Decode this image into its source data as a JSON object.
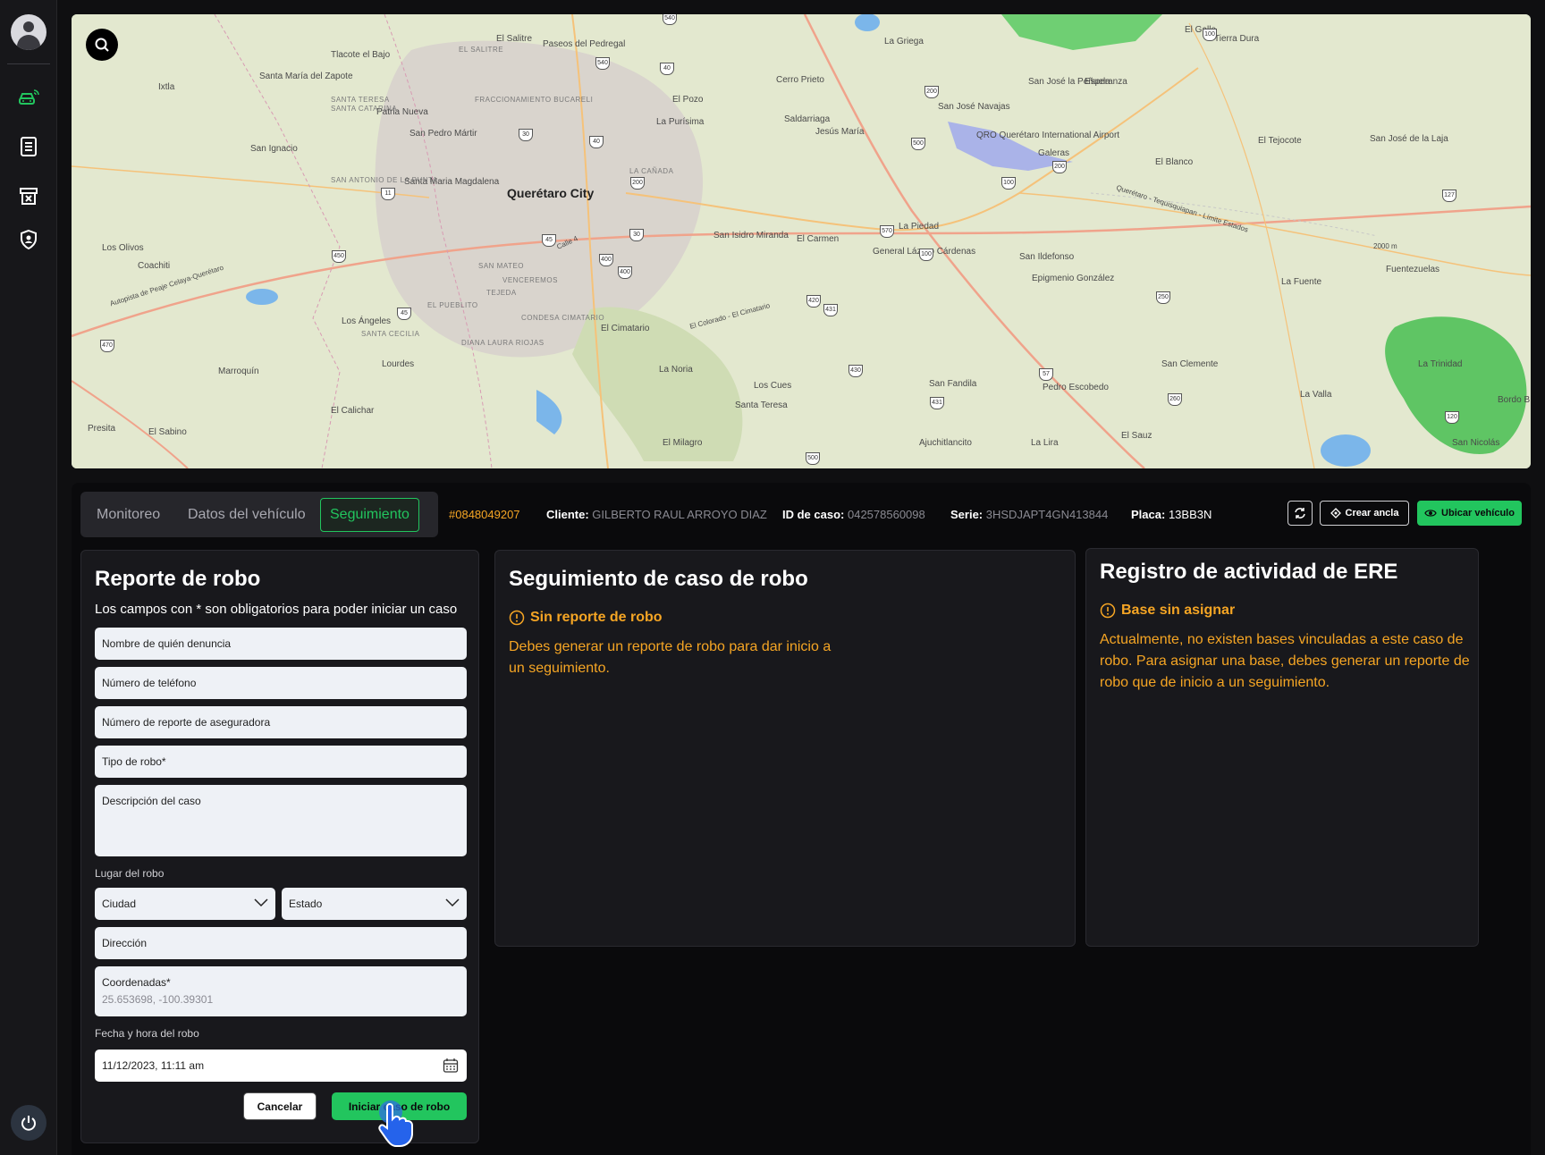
{
  "sidebar": {
    "items": [
      {
        "icon": "car-signal-icon",
        "label": "Vehículos"
      },
      {
        "icon": "report-list-icon",
        "label": "Reportes"
      },
      {
        "icon": "archive-x-icon",
        "label": "Archivo"
      },
      {
        "icon": "shield-user-icon",
        "label": "Seguridad"
      }
    ]
  },
  "map": {
    "labels": [
      "Querétaro City",
      "Santa María del Zapote",
      "Tlacote el Bajo",
      "El Salitre",
      "Paseos del Pedregal",
      "La Griega",
      "El Gallo",
      "Tierra Dura",
      "San Ignacio",
      "San Pedro Mártir",
      "Santa Maria Magdalena",
      "El Pozo",
      "La Purísima",
      "Cerro Prieto",
      "Saldarriaga",
      "Jesús María",
      "San José Navajas",
      "San José la Peñuela",
      "Esperanza",
      "Galeras",
      "El Blanco",
      "El Tejocote",
      "San José de la Laja",
      "QRO Querétaro International Airport",
      "La Piedad",
      "El Carmen",
      "San Isidro Miranda",
      "General Lázaro Cárdenas",
      "San Ildefonso",
      "Epigmenio González",
      "La Fuente",
      "Fuentezuelas",
      "Los Ángeles",
      "Lourdes",
      "El Cimatario",
      "La Noria",
      "San Clemente",
      "Pedro Escobedo",
      "San Fandila",
      "Los Cues",
      "La Valla",
      "La Trinidad",
      "El Calichar",
      "Santa Teresa",
      "El Milagro",
      "Ajuchitlancito",
      "La Lira",
      "El Sauz",
      "San Nicolás",
      "Bordo B",
      "Patria Nueva",
      "Marroquín",
      "El Sabino",
      "Presita",
      "Coachiti",
      "Los Olivos",
      "Ixtla"
    ],
    "districts": [
      "EL SALITRE",
      "FRACCIONAMIENTO BUCARELI",
      "SANTA CATARINA",
      "SANTA TERESA",
      "SAN MATEO",
      "VENCEREMOS",
      "EL PUEBLITO",
      "TEJEDA",
      "CONDESA CIMATARIO",
      "DIANA LAURA RIOJAS",
      "SANTA CECILIA",
      "LA CAÑADA",
      "SAN ANTONIO DE LA PUNTA"
    ],
    "road_labels": [
      "Autopista de Peaje Celaya-Querétaro",
      "Calle 4",
      "El Colorado - El Cimatario",
      "Querétaro - Tequisquiapan - Límite Estados",
      "2000 m"
    ],
    "highways": [
      "540",
      "540",
      "40",
      "30",
      "40",
      "200",
      "200",
      "11",
      "45",
      "30",
      "400",
      "400",
      "450",
      "45",
      "470",
      "420",
      "431",
      "570",
      "100",
      "100",
      "200",
      "500",
      "100",
      "127",
      "250",
      "57",
      "430",
      "431",
      "260",
      "120",
      "500"
    ]
  },
  "tabs": {
    "monitoreo": "Monitoreo",
    "datos": "Datos del vehículo",
    "seguimiento": "Seguimiento"
  },
  "case": {
    "number": "#0848049207",
    "cliente_label": "Cliente:",
    "cliente": "GILBERTO RAUL ARROYO DIAZ",
    "id_label": "ID de caso:",
    "id": "042578560098",
    "serie_label": "Serie:",
    "serie": "3HSDJAPT4GN413844",
    "placa_label": "Placa:",
    "placa": "13BB3N"
  },
  "toolbar": {
    "crear_ancla": "Crear ancla",
    "ubicar": "Ubicar vehículo"
  },
  "form": {
    "title": "Reporte de robo",
    "subtitle": "Los campos con * son obligatorios para poder iniciar un caso",
    "denunciante": "Nombre de quién denuncia",
    "telefono": "Número de teléfono",
    "reporte_aseguradora": "Número de reporte de aseguradora",
    "tipo_robo": "Tipo de robo*",
    "descripcion": "Descripción del caso",
    "lugar_label": "Lugar del robo",
    "ciudad": "Ciudad",
    "estado": "Estado",
    "direccion": "Dirección",
    "coordenadas_label": "Coordenadas*",
    "coordenadas_value": "25.653698, -100.39301",
    "fecha_label": "Fecha y hora del robo",
    "fecha_value": "11/12/2023, 11:11 am",
    "cancel": "Cancelar",
    "submit": "Iniciar caso de robo"
  },
  "seguimiento": {
    "title": "Seguimiento de caso de robo",
    "warn_title": "Sin reporte de robo",
    "warn_body": "Debes generar un reporte de robo para dar inicio a un seguimiento."
  },
  "registro": {
    "title": "Registro de actividad de ERE",
    "warn_title": "Base sin asignar",
    "warn_body": "Actualmente, no existen bases vinculadas a este caso de robo. Para asignar una base, debes generar un reporte de robo que de inicio a un seguimiento."
  },
  "colors": {
    "accent": "#22c55e",
    "warning": "#f5a524",
    "background": "#0a0a0c",
    "card": "#18181c",
    "field": "#eef1f6"
  }
}
